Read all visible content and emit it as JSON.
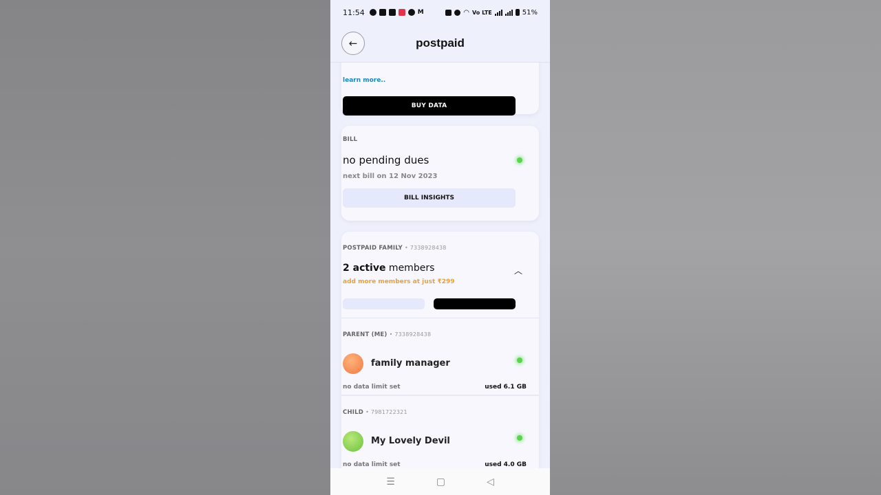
{
  "status_bar": {
    "time": "11:54",
    "network_label": "Vo LTE",
    "battery": "51%"
  },
  "header": {
    "title": "postpaid",
    "back_icon": "arrow-left-icon"
  },
  "data_card": {
    "learn_more": "learn more..",
    "buy_button": "BUY DATA"
  },
  "bill_card": {
    "label": "BILL",
    "status": "no pending dues",
    "next_bill": "next bill on 12 Nov 2023",
    "insights_button": "BILL INSIGHTS"
  },
  "family_card": {
    "label": "POSTPAID FAMILY",
    "number": "• 7338928438",
    "active_count": "2 active",
    "members_word": " members",
    "add_more": "add more members at just ₹299",
    "members": [
      {
        "role": "PARENT (ME)",
        "number": "• 7338928438",
        "name": "family manager",
        "limit": "no data limit set",
        "used": "used 6.1 GB"
      },
      {
        "role": "CHILD",
        "number": "• 7981722321",
        "name": "My Lovely Devil",
        "limit": "no data limit set",
        "used": "used 4.0 GB"
      }
    ]
  },
  "nav_bar": {
    "menu_icon": "☰",
    "home_icon": "▢",
    "back_icon": "◁"
  },
  "colors": {
    "accent_link": "#1f86b8",
    "offer_orange": "#e8a13c",
    "status_green": "#5bd34f"
  }
}
